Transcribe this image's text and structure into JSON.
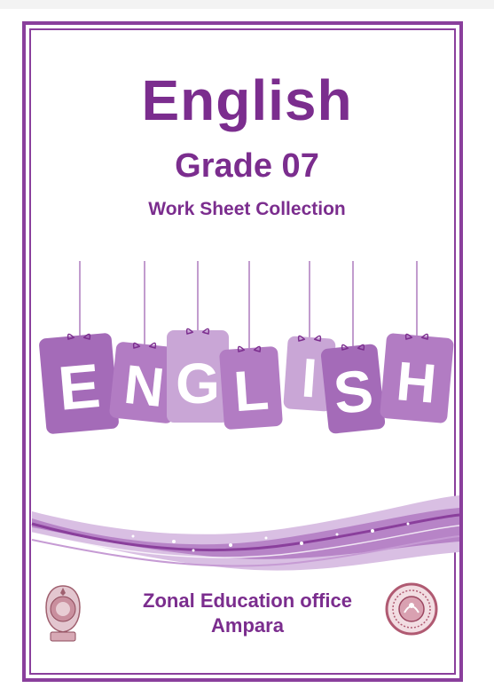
{
  "document": {
    "title": "English",
    "grade": "Grade 07",
    "subtitle": "Work Sheet Collection",
    "banner_letters": [
      "E",
      "N",
      "G",
      "L",
      "I",
      "S",
      "H"
    ],
    "office": "Zonal Education office",
    "location": "Ampara"
  },
  "colors": {
    "primary": "#7b2d8e",
    "frame": "#8a3f9c",
    "tag_light": "#c9a6d6",
    "tag_dark": "#a46bb8"
  },
  "icons": {
    "left_seal": "sri-lanka-emblem-icon",
    "right_seal": "provincial-education-seal-icon"
  }
}
